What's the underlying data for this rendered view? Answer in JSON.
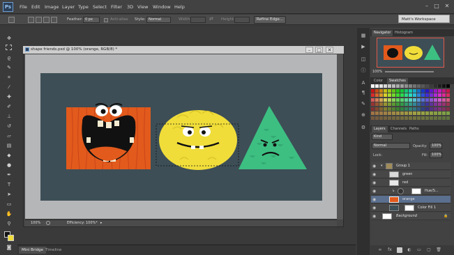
{
  "app": {
    "logo": "Ps"
  },
  "menu": [
    "File",
    "Edit",
    "Image",
    "Layer",
    "Type",
    "Select",
    "Filter",
    "3D",
    "View",
    "Window",
    "Help"
  ],
  "window_controls": [
    "–",
    "□",
    "✕"
  ],
  "options": {
    "feather_label": "Feather:",
    "feather_value": "0 px",
    "anti_alias_label": "Anti-alias",
    "style_label": "Style:",
    "style_value": "Normal",
    "width_label": "Width:",
    "height_label": "Height:",
    "refine_edge": "Refine Edge...",
    "workspace": "Matt's Workspace"
  },
  "document": {
    "title": "shape friends.psd @ 100% (orange, RGB/8) *",
    "zoom": "100%",
    "efficiency": "Efficiency: 100%*"
  },
  "bottom_tabs": [
    "Mini Bridge",
    "Timeline"
  ],
  "navigator": {
    "tabs": [
      "Navigator",
      "Histogram"
    ],
    "zoom": "100%"
  },
  "color_panel": {
    "tabs": [
      "Color",
      "Swatches"
    ]
  },
  "layers_panel": {
    "tabs": [
      "Layers",
      "Channels",
      "Paths"
    ],
    "kind": "Kind",
    "blend_mode": "Normal",
    "opacity_label": "Opacity:",
    "opacity_value": "100%",
    "lock_label": "Lock:",
    "fill_label": "Fill:",
    "fill_value": "100%",
    "layers": [
      {
        "name": "Group 1"
      },
      {
        "name": "green"
      },
      {
        "name": "red"
      },
      {
        "name": "Hue/S..."
      },
      {
        "name": "orange"
      },
      {
        "name": "Color Fill 1"
      },
      {
        "name": "Background"
      }
    ]
  },
  "colors": {
    "orange": "#e25a1c",
    "yellow": "#f0dd3a",
    "green": "#3dbf82",
    "canvas": "#3d4e56",
    "selection": "#5b6f8e"
  }
}
